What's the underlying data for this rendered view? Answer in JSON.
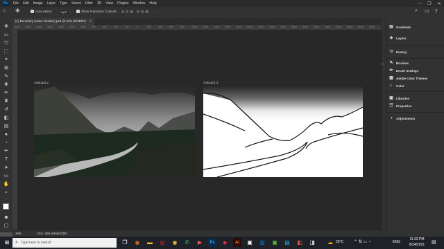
{
  "menubar": {
    "logo": "Ps",
    "items": [
      "File",
      "Edit",
      "Image",
      "Layer",
      "Type",
      "Select",
      "Filter",
      "3D",
      "View",
      "Plugins",
      "Window",
      "Help"
    ],
    "window_controls": [
      "—",
      "❐",
      "✕"
    ]
  },
  "options": {
    "auto_select_label": "Auto-Select:",
    "auto_select_target": "Layer",
    "show_transform_label": "Show Transform Controls"
  },
  "document": {
    "tab_title": "(1) Boundary (Value Studies).psd @ 34% (RGB/8*)",
    "tab_close": "×",
    "zoom": "34%",
    "doc_info": "Doc: 259.4M/461.3M"
  },
  "ruler": {
    "ticks": [
      "2200",
      "2000",
      "1800",
      "1600",
      "1400",
      "1200",
      "1000",
      "800",
      "600",
      "400",
      "200",
      "0",
      "200",
      "400",
      "600",
      "800",
      "1000",
      "1200",
      "1400",
      "1600",
      "1800",
      "2000",
      "2200",
      "2400",
      "2600",
      "2800",
      "3000",
      "3200",
      "3400",
      "3600",
      "3800",
      "4000",
      "4200"
    ]
  },
  "artboards": [
    {
      "label": "Artboard 2"
    },
    {
      "label": "Artboard 3"
    }
  ],
  "panels": {
    "group1": [
      "Gradients",
      "Layers"
    ],
    "group2": [
      "History"
    ],
    "group3": [
      "Brushes",
      "Brush Settings",
      "Adobe Color Themes",
      "Color"
    ],
    "group4": [
      "Libraries",
      "Properties"
    ],
    "group5": [
      "Adjustments"
    ]
  },
  "taskbar": {
    "search_placeholder": "Type here to search",
    "weather": "26°C",
    "language": "ENG",
    "time": "11:32 PM",
    "date": "8/24/2021"
  },
  "colors": {
    "accent": "#31a8ff",
    "ui_dark": "#323232",
    "canvas_bg": "#282828"
  }
}
